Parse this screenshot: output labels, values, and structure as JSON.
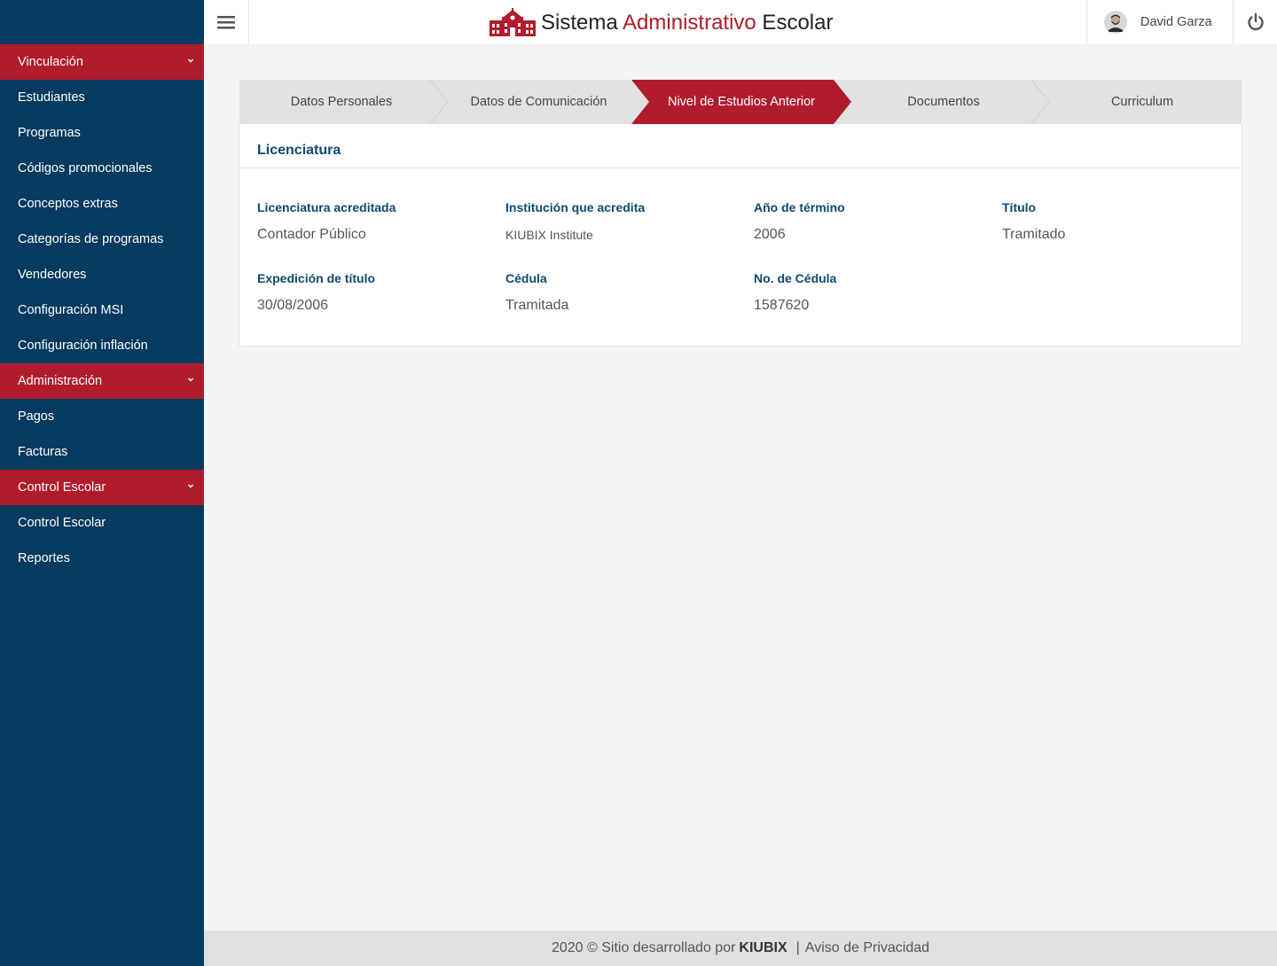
{
  "header": {
    "brand_part1": "Sistema ",
    "brand_part2": "Administrativo",
    "brand_part3": " Escolar",
    "user_name": "David Garza"
  },
  "sidebar": {
    "items": [
      {
        "label": "Vinculación",
        "section": true
      },
      {
        "label": "Estudiantes"
      },
      {
        "label": "Programas"
      },
      {
        "label": "Códigos promocionales"
      },
      {
        "label": "Conceptos extras"
      },
      {
        "label": "Categorías de programas"
      },
      {
        "label": "Vendedores"
      },
      {
        "label": "Configuración MSI"
      },
      {
        "label": "Configuración inflación"
      },
      {
        "label": "Administración",
        "section": true
      },
      {
        "label": "Pagos"
      },
      {
        "label": "Facturas"
      },
      {
        "label": "Control Escolar",
        "section": true
      },
      {
        "label": "Control Escolar"
      },
      {
        "label": "Reportes"
      }
    ]
  },
  "steps": {
    "items": [
      {
        "label": "Datos Personales"
      },
      {
        "label": "Datos de Comunicación"
      },
      {
        "label": "Nivel de Estudios Anterior",
        "active": true
      },
      {
        "label": "Documentos"
      },
      {
        "label": "Curriculum"
      }
    ]
  },
  "card": {
    "title": "Licenciatura",
    "fields": [
      {
        "label": "Licenciatura acreditada",
        "value": "Contador Público"
      },
      {
        "label": "Institución que acredita",
        "value": "KIUBIX Institute"
      },
      {
        "label": "Año de término",
        "value": "2006"
      },
      {
        "label": "Título",
        "value": "Tramitado"
      },
      {
        "label": "Expedición de título",
        "value": "30/08/2006"
      },
      {
        "label": "Cédula",
        "value": "Tramitada"
      },
      {
        "label": "No. de Cédula",
        "value": "1587620"
      }
    ]
  },
  "footer": {
    "prefix": "2020 © Sitio desarrollado por",
    "company": "KIUBIX",
    "separator": "|",
    "privacy": "Aviso de Privacidad"
  },
  "colors": {
    "sidebar_bg": "#063a5e",
    "accent_red": "#b01c2c",
    "label_blue": "#0d4a72"
  }
}
